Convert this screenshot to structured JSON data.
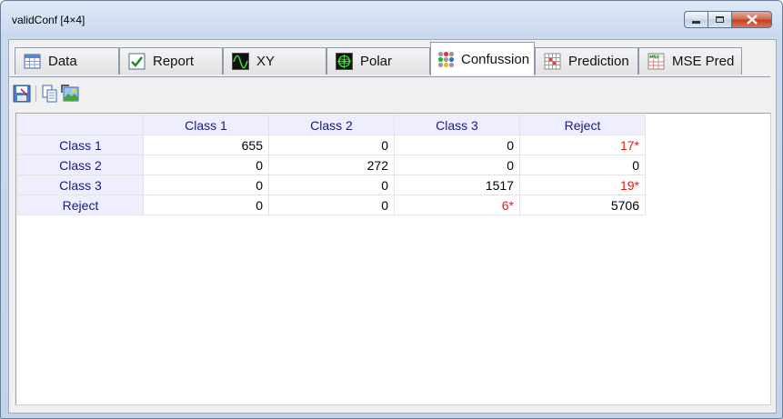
{
  "window": {
    "title": "validConf [4×4]"
  },
  "window_buttons": [
    "minimize-icon",
    "maximize-icon",
    "close-icon"
  ],
  "tabs": [
    {
      "label": "Data",
      "icon": "table-icon",
      "active": false
    },
    {
      "label": "Report",
      "icon": "checkmark-icon",
      "active": false
    },
    {
      "label": "XY",
      "icon": "sine-wave-icon",
      "active": false
    },
    {
      "label": "Polar",
      "icon": "polar-plot-icon",
      "active": false
    },
    {
      "label": "Confussion",
      "icon": "colored-dots-icon",
      "active": true
    },
    {
      "label": "Prediction",
      "icon": "grid-chart-icon",
      "active": false
    },
    {
      "label": "MSE Pred",
      "icon": "mse-icon",
      "active": false
    }
  ],
  "toolbar": {
    "buttons": [
      "save-icon",
      "copy-icon",
      "export-image-icon"
    ]
  },
  "colors": {
    "header_bg": "#eeeeff",
    "header_text": "#1a1a7a",
    "reject_highlight": "#e01818"
  },
  "matrix": {
    "columns": [
      "Class 1",
      "Class 2",
      "Class 3",
      "Reject"
    ],
    "rows": [
      {
        "label": "Class 1",
        "cells": [
          {
            "v": "655"
          },
          {
            "v": "0"
          },
          {
            "v": "0"
          },
          {
            "v": "17*",
            "err": true
          }
        ]
      },
      {
        "label": "Class 2",
        "cells": [
          {
            "v": "0"
          },
          {
            "v": "272"
          },
          {
            "v": "0"
          },
          {
            "v": "0"
          }
        ]
      },
      {
        "label": "Class 3",
        "cells": [
          {
            "v": "0"
          },
          {
            "v": "0"
          },
          {
            "v": "1517"
          },
          {
            "v": "19*",
            "err": true
          }
        ]
      },
      {
        "label": "Reject",
        "cells": [
          {
            "v": "0"
          },
          {
            "v": "0"
          },
          {
            "v": "6*",
            "err": true
          },
          {
            "v": "5706"
          }
        ]
      }
    ]
  }
}
